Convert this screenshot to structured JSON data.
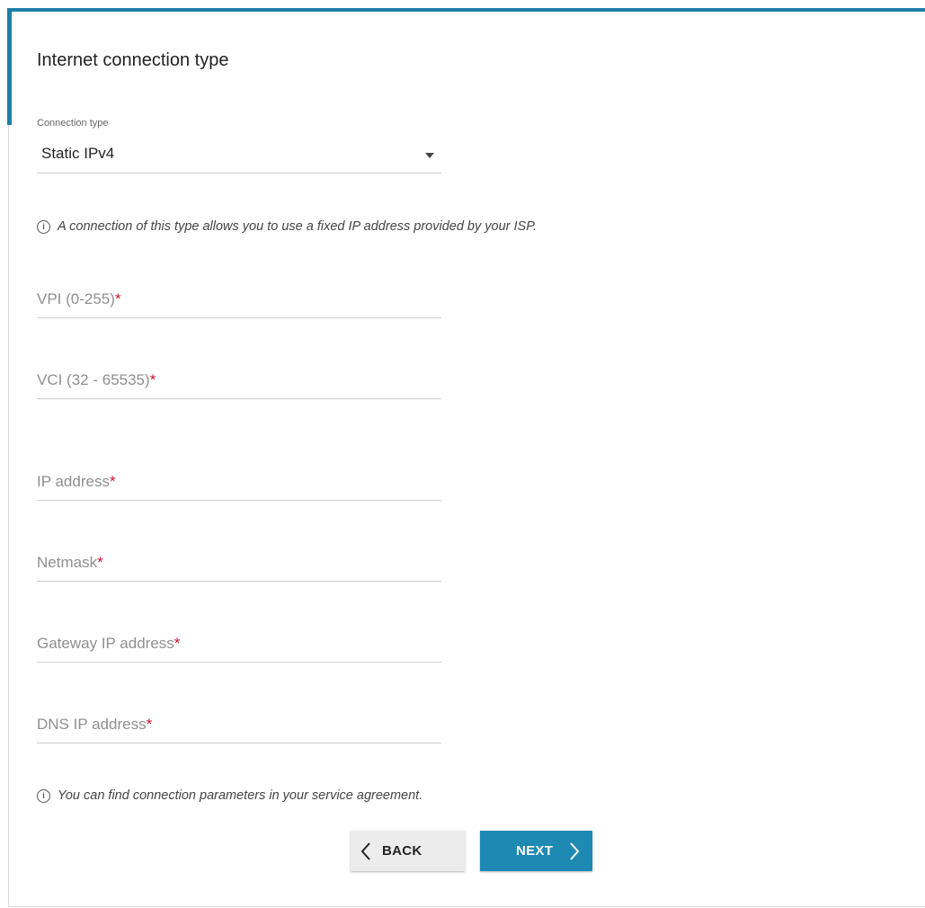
{
  "page": {
    "title": "Internet connection type"
  },
  "connection_type": {
    "label": "Connection type",
    "value": "Static IPv4"
  },
  "info_note": "A connection of this type allows you to use a fixed IP address provided by your ISP.",
  "fields": {
    "vpi": {
      "placeholder": "VPI (0-255)",
      "required_mark": "*"
    },
    "vci": {
      "placeholder": "VCI (32 - 65535)",
      "required_mark": "*"
    },
    "ip_address": {
      "placeholder": "IP address",
      "required_mark": "*"
    },
    "netmask": {
      "placeholder": "Netmask",
      "required_mark": "*"
    },
    "gateway": {
      "placeholder": "Gateway IP address",
      "required_mark": "*"
    },
    "dns": {
      "placeholder": "DNS IP address",
      "required_mark": "*"
    }
  },
  "footer_note": "You can find connection parameters in your service agreement.",
  "buttons": {
    "back": "BACK",
    "next": "NEXT"
  },
  "colors": {
    "accent": "#1e7fa8",
    "primary_button": "#1e8ab4",
    "required": "#c8102e"
  },
  "icons": {
    "info": "info-circle-icon",
    "back": "chevron-left-icon",
    "next": "chevron-right-icon",
    "select_caret": "caret-down-icon"
  }
}
